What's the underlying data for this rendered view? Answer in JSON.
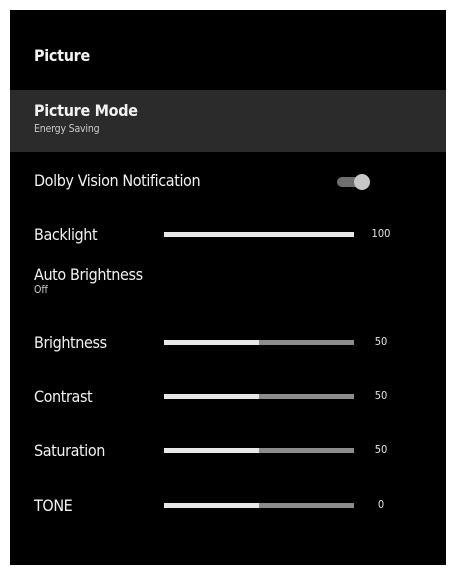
{
  "header": {
    "title": "Picture"
  },
  "picture_mode": {
    "label": "Picture Mode",
    "value": "Energy Saving"
  },
  "dolby": {
    "label": "Dolby Vision Notification",
    "enabled": true
  },
  "backlight": {
    "label": "Backlight",
    "value": "100",
    "level": 1.0
  },
  "auto_brightness": {
    "label": "Auto Brightness",
    "value": "Off"
  },
  "brightness": {
    "label": "Brightness",
    "value": "50",
    "level": 0.5
  },
  "contrast": {
    "label": "Contrast",
    "value": "50",
    "level": 0.5
  },
  "saturation": {
    "label": "Saturation",
    "value": "50",
    "level": 0.5
  },
  "tone": {
    "label": "TONE",
    "value": "0",
    "level": 0.5
  }
}
